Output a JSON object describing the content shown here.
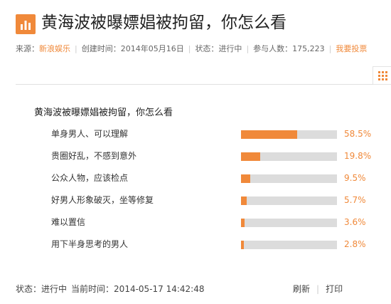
{
  "header": {
    "title": "黄海波被曝嫖娼被拘留，你怎么看",
    "icon": "bar-chart-icon"
  },
  "meta": {
    "source_label": "来源：",
    "source_value": "新浪娱乐",
    "created_label": "创建时间：",
    "created_value": "2014年05月16日",
    "status_label": "状态：",
    "status_value": "进行中",
    "participants_label": "参与人数：",
    "participants_value": "175,223",
    "vote_link": "我要投票"
  },
  "side_button": {
    "icon": "grid-icon"
  },
  "poll": {
    "question": "黄海波被曝嫖娼被拘留，你怎么看",
    "options": [
      {
        "label": "单身男人、可以理解",
        "percent_text": "58.5%",
        "percent": 58.5
      },
      {
        "label": "贵圈好乱，不感到意外",
        "percent_text": "19.8%",
        "percent": 19.8
      },
      {
        "label": "公众人物，应该检点",
        "percent_text": "9.5%",
        "percent": 9.5
      },
      {
        "label": "好男人形象破灭，坐等修复",
        "percent_text": "5.7%",
        "percent": 5.7
      },
      {
        "label": "难以置信",
        "percent_text": "3.6%",
        "percent": 3.6
      },
      {
        "label": "用下半身思考的男人",
        "percent_text": "2.8%",
        "percent": 2.8
      }
    ]
  },
  "footer": {
    "status_label": "状态：",
    "status_value": "进行中",
    "time_label": "当前时间：",
    "time_value": "2014-05-17 14:42:48",
    "refresh_label": "刷新",
    "print_label": "打印"
  },
  "colors": {
    "accent": "#f0893a",
    "track": "#dcdcdc"
  }
}
